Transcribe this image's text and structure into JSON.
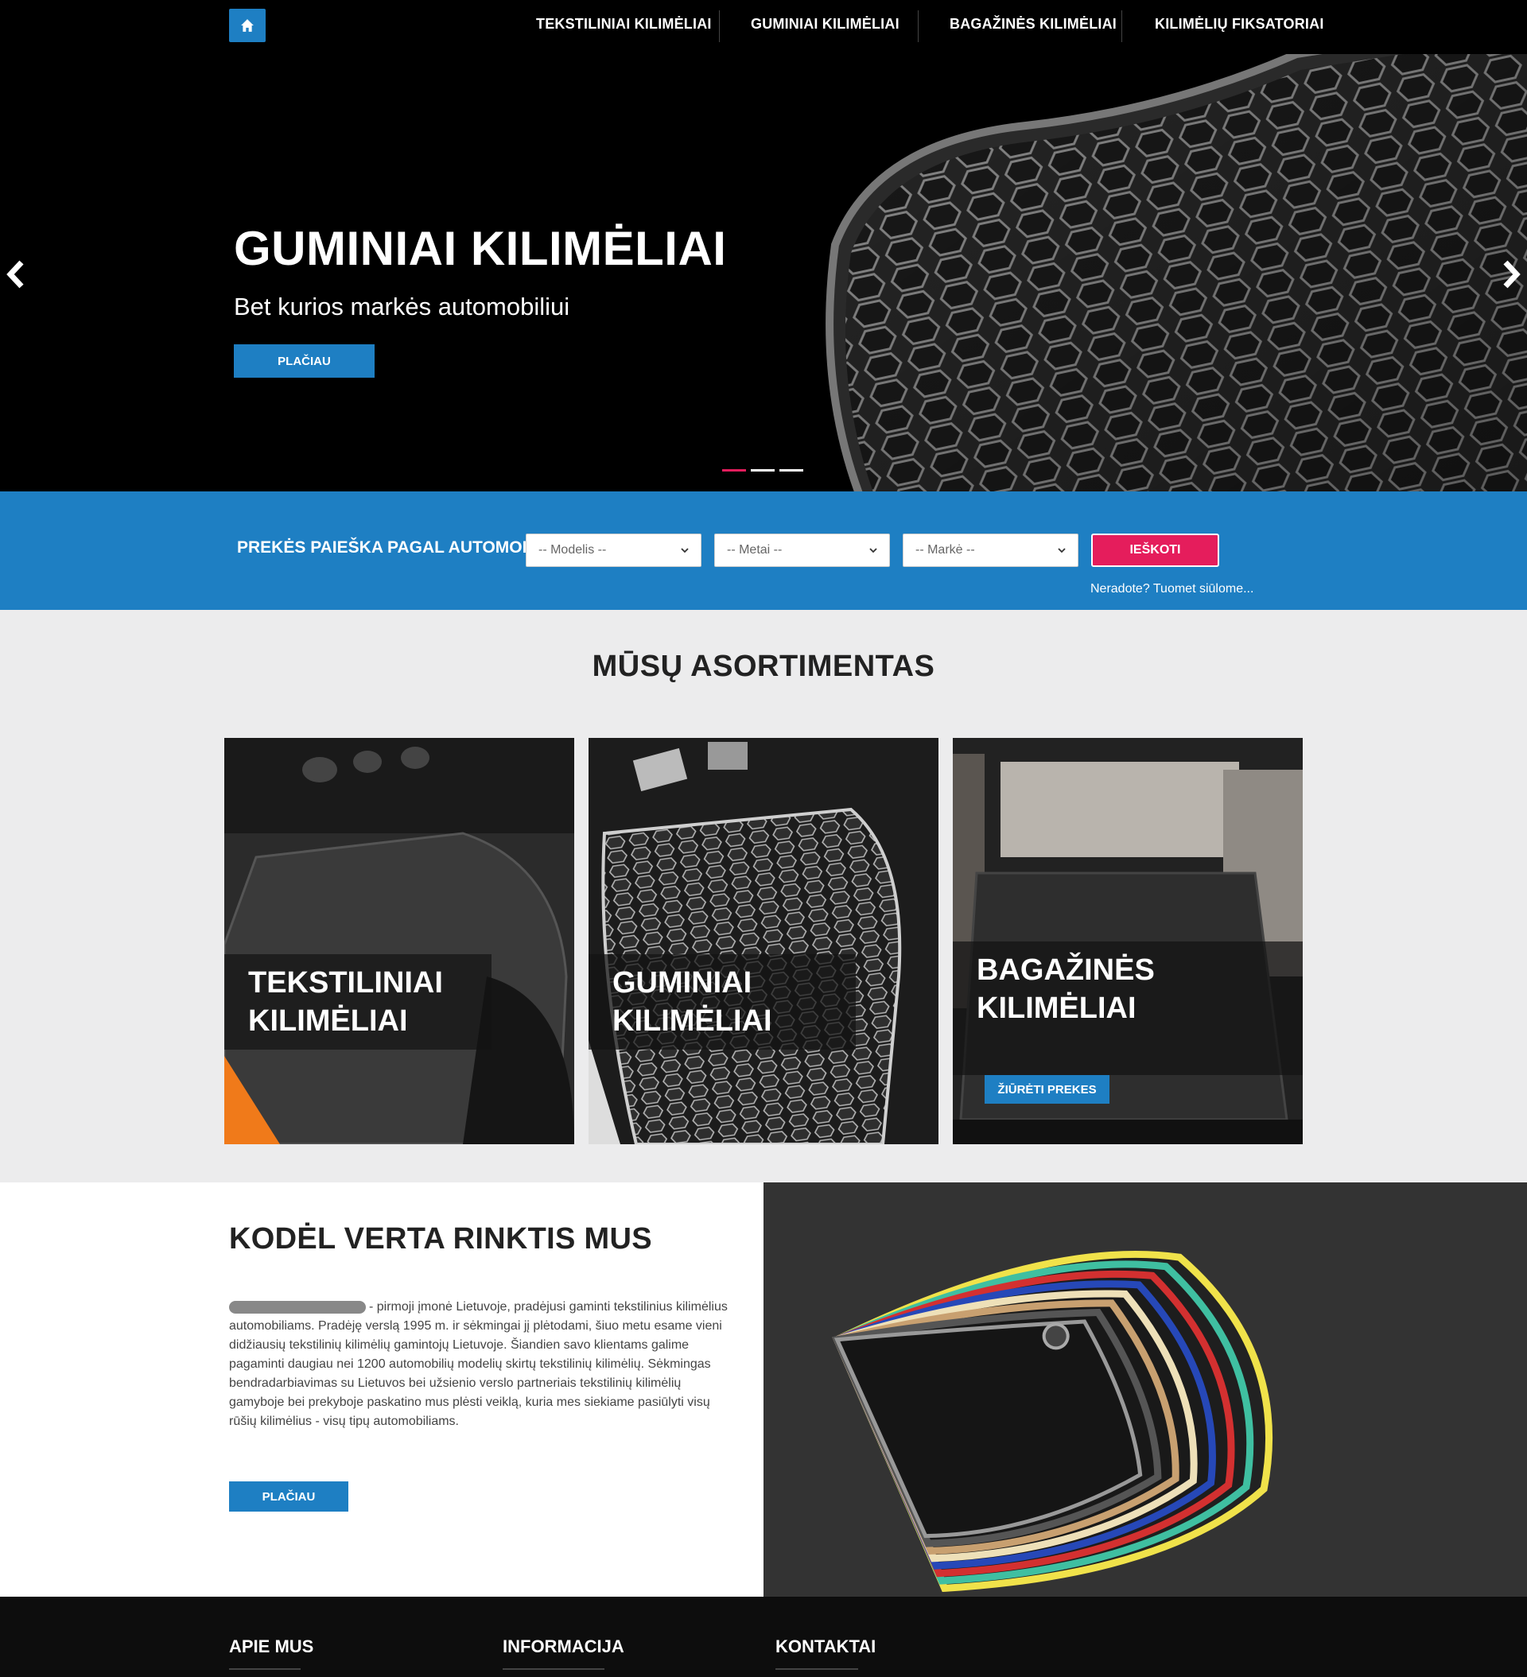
{
  "nav": {
    "items": [
      {
        "label": "TEKSTILINIAI KILIMĖLIAI"
      },
      {
        "label": "GUMINIAI KILIMĖLIAI"
      },
      {
        "label": "BAGAŽINĖS KILIMĖLIAI"
      },
      {
        "label": "KILIMĖLIŲ FIKSATORIAI"
      }
    ]
  },
  "hero": {
    "title": "GUMINIAI KILIMĖLIAI",
    "subtitle": "Bet kurios markės automobiliui",
    "button": "PLAČIAU",
    "active_slide": 1,
    "slide_count": 3
  },
  "search": {
    "label": "PREKĖS PAIEŠKA PAGAL AUTOMOBILĮ:",
    "model": "-- Modelis --",
    "year": "-- Metai --",
    "make": "-- Markė --",
    "button": "IEŠKOTI",
    "link": "Neradote? Tuomet siūlome..."
  },
  "assortment": {
    "title": "MŪSŲ ASORTIMENTAS",
    "cards": [
      {
        "line1": "TEKSTILINIAI",
        "line2": "KILIMĖLIAI"
      },
      {
        "line1": "GUMINIAI",
        "line2": "KILIMĖLIAI"
      },
      {
        "line1": "BAGAŽINĖS KILIMĖLIAI",
        "button": "ŽIŪRĖTI PREKES"
      }
    ]
  },
  "why": {
    "title": "KODĖL VERTA RINKTIS MUS",
    "text": "- pirmoji įmonė Lietuvoje, pradėjusi gaminti tekstilinius kilimėlius automobiliams. Pradėję verslą 1995 m. ir sėkmingai jį plėtodami, šiuo metu esame vieni didžiausių tekstilinių kilimėlių gamintojų Lietuvoje. Šiandien savo klientams galime pagaminti daugiau nei 1200 automobilių modelių skirtų tekstilinių kilimėlių. Sėkmingas bendradarbiavimas su Lietuvos bei užsienio verslo partneriais tekstilinių kilimėlių gamyboje bei prekyboje paskatino mus plėsti veiklą, kuria mes siekiame pasiūlyti visų rūšių kilimėlius - visų tipų automobiliams.",
    "button": "PLAČIAU"
  },
  "footer": {
    "col1": "APIE MUS",
    "col2": "INFORMACIJA",
    "col3": "KONTAKTAI"
  },
  "colors": {
    "primary": "#1e7fc3",
    "accent": "#e51d5c",
    "dark": "#000000",
    "light_bg": "#ececed"
  }
}
